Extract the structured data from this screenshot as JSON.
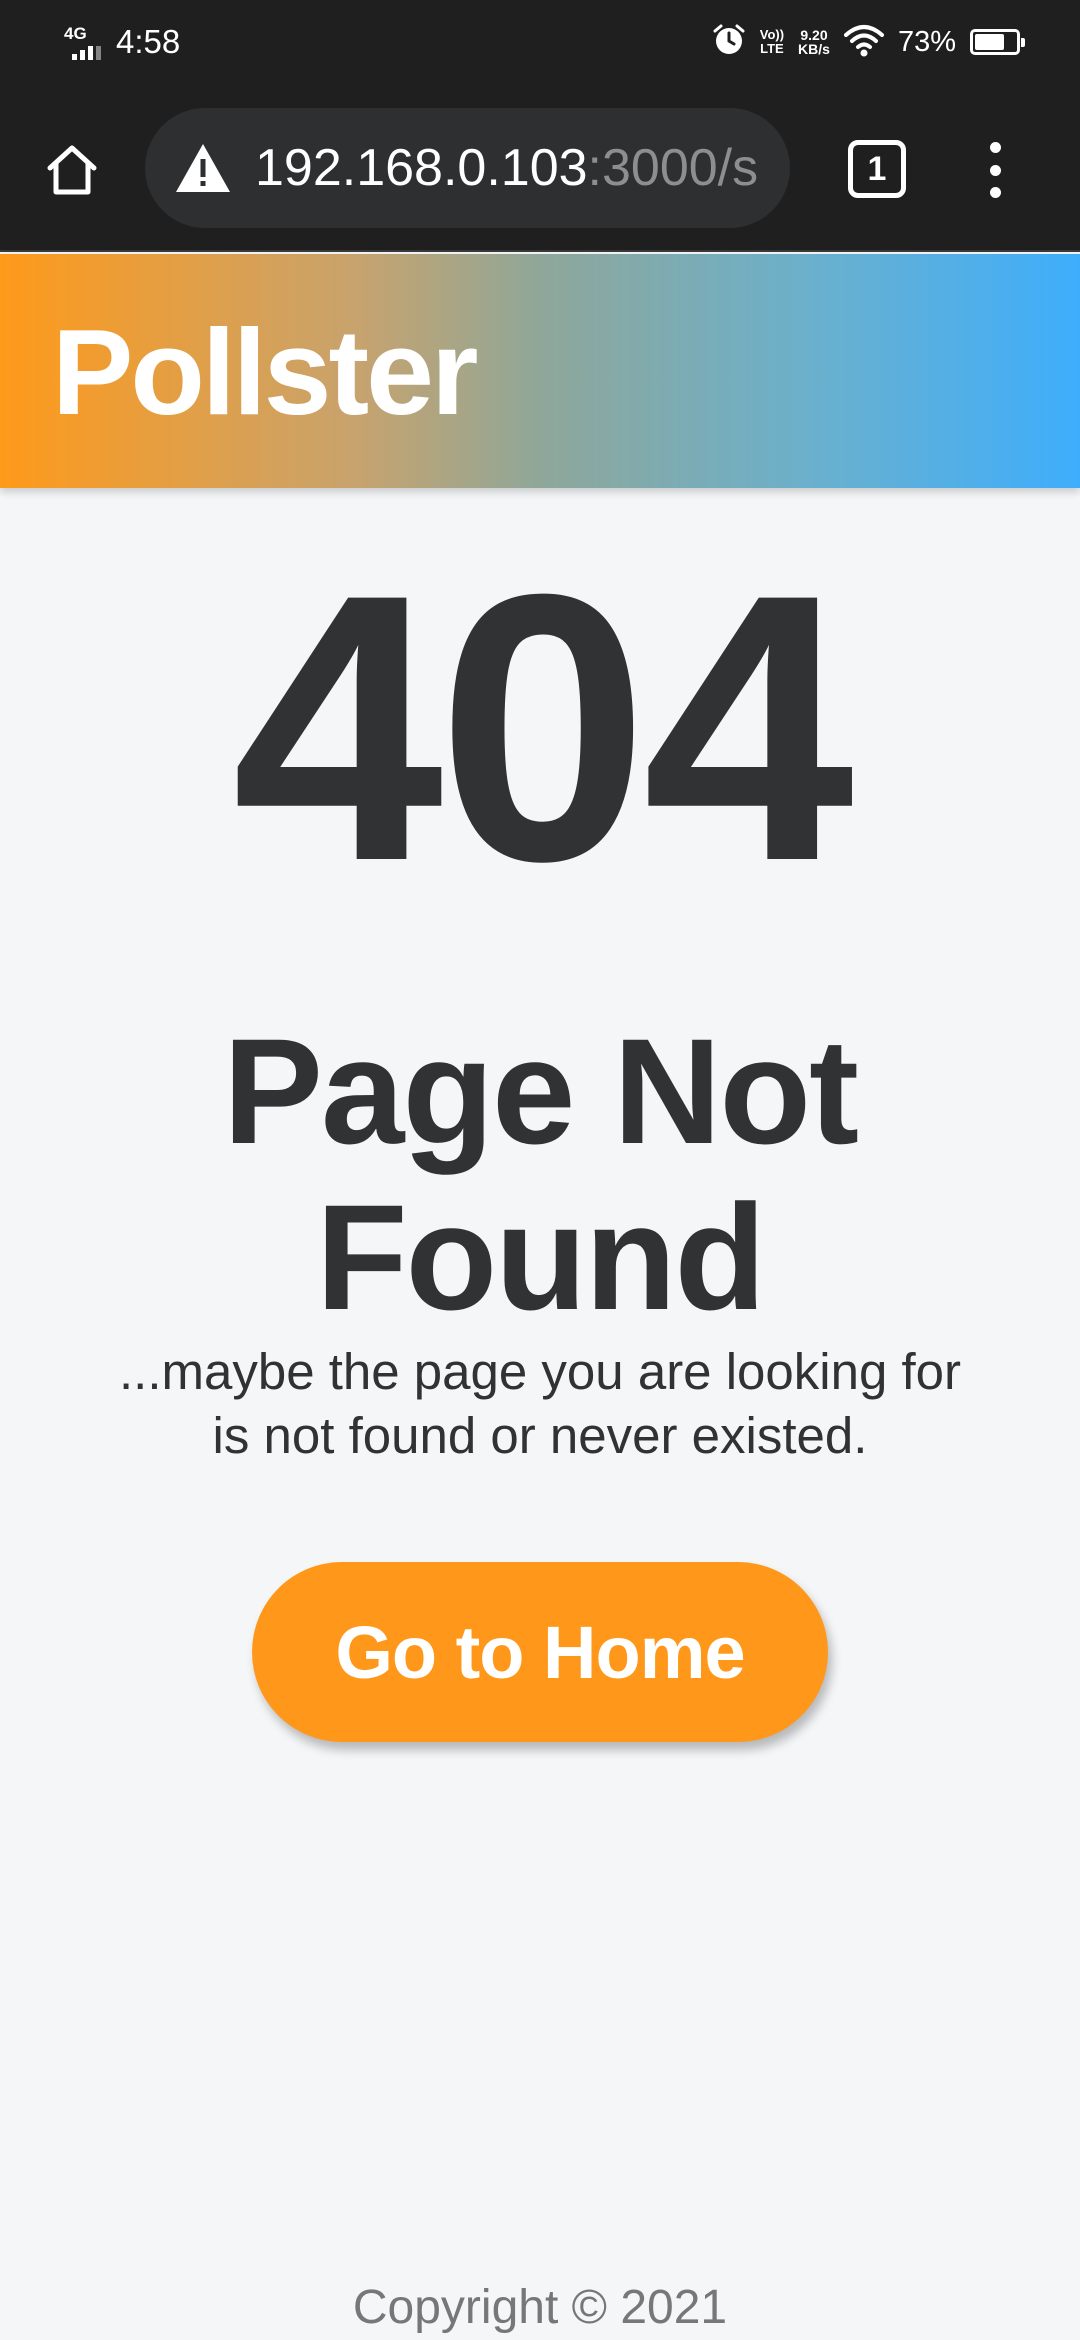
{
  "status_bar": {
    "network": "4G",
    "time": "4:58",
    "volte_line1": "Vo))",
    "volte_line2": "LTE",
    "speed_value": "9.20",
    "speed_unit": "KB/s",
    "battery_percent": "73%",
    "battery_level": 0.73,
    "icons": [
      "alarm-icon",
      "wifi-icon",
      "battery-icon"
    ]
  },
  "browser": {
    "url_host": "192.168.0.103",
    "url_rest": ":3000/s",
    "tab_count": "1",
    "icons": [
      "home-icon",
      "warning-icon",
      "tabs-icon",
      "more-vert-icon"
    ]
  },
  "header": {
    "brand": "Pollster",
    "gradient_colors": [
      "#ff9a1a",
      "#3eaefc"
    ]
  },
  "main": {
    "code": "404",
    "title_line1": "Page Not",
    "title_line2": "Found",
    "subtitle_line1": "...maybe the page you are looking for",
    "subtitle_line2": "is not found or never existed.",
    "button_label": "Go to Home",
    "button_color": "#ff981a"
  },
  "footer": {
    "copyright": "Copyright © 2021"
  }
}
